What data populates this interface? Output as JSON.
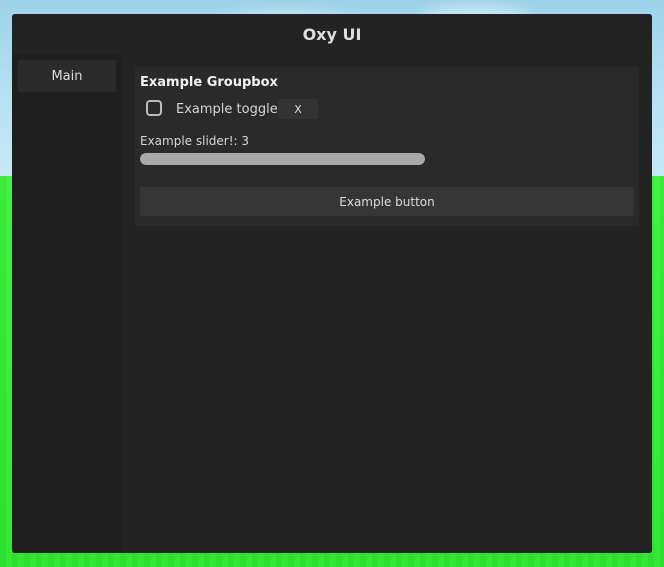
{
  "window": {
    "title": "Oxy UI"
  },
  "sidebar": {
    "tabs": [
      {
        "label": "Main"
      }
    ]
  },
  "groupbox": {
    "title": "Example Groupbox",
    "toggle": {
      "label": "Example toggle",
      "checked": false,
      "keybind": "X"
    },
    "slider": {
      "label": "Example slider!: 3",
      "value": 3,
      "fill_fraction": 1.0
    },
    "button": {
      "label": "Example button"
    }
  },
  "colors": {
    "window_bg": "#1c1c1c",
    "titlebar_bg": "#232323",
    "groupbox_bg": "#2a2a2a",
    "button_bg": "#363636",
    "slider_fill": "#a9a9a9",
    "sky": "#b9e2f2",
    "ground": "#35ec35"
  }
}
